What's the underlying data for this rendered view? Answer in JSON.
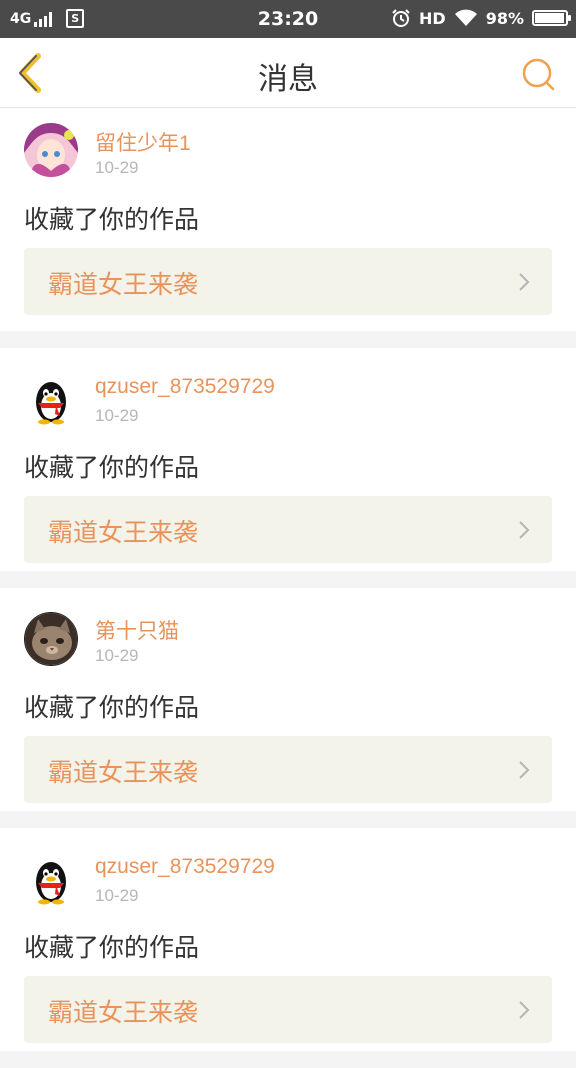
{
  "status_bar": {
    "network": "4G",
    "sim_label": "S",
    "time": "23:20",
    "hd_label": "HD",
    "battery_text": "98%",
    "battery_level": 0.98
  },
  "nav": {
    "title": "消息",
    "icons": {
      "back": "chevron-left-icon",
      "search": "search-icon"
    },
    "accent_color": "#f0a050"
  },
  "messages": [
    {
      "username": "留住少年1",
      "date": "10-29",
      "action": "收藏了你的作品",
      "work_title": "霸道女王来袭",
      "avatar": "anime-girl-avatar"
    },
    {
      "username": "qzuser_873529729",
      "date": "10-29",
      "action": "收藏了你的作品",
      "work_title": "霸道女王来袭",
      "avatar": "penguin-avatar"
    },
    {
      "username": "第十只猫",
      "date": "10-29",
      "action": "收藏了你的作品",
      "work_title": "霸道女王来袭",
      "avatar": "cat-avatar"
    },
    {
      "username": "qzuser_873529729",
      "date": "10-29",
      "action": "收藏了你的作品",
      "work_title": "霸道女王来袭",
      "avatar": "penguin-avatar"
    }
  ],
  "colors": {
    "username": "#e8935a",
    "link_bg": "#f3f3ea",
    "date": "#b6b6b6"
  }
}
